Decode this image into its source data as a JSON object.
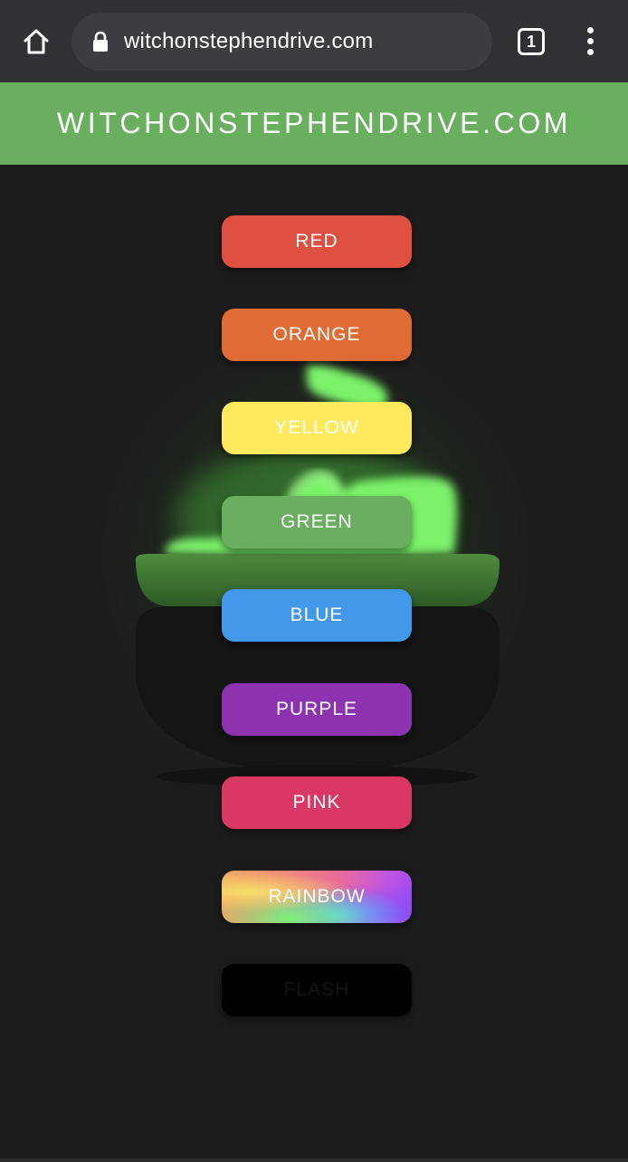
{
  "browser": {
    "url": "witchonstephendrive.com",
    "tab_count": "1",
    "icons": {
      "home": "home-icon",
      "lock": "lock-icon",
      "tabs": "tab-switcher-icon",
      "menu": "more-vert-icon"
    }
  },
  "header": {
    "title": "WITCHONSTEPHENDRIVE.COM",
    "background": "#6aaf5f"
  },
  "buttons": [
    {
      "label": "RED",
      "color": "#e05040"
    },
    {
      "label": "ORANGE",
      "color": "#e06b35"
    },
    {
      "label": "YELLOW",
      "color": "#ffe95c"
    },
    {
      "label": "GREEN",
      "color": "#6aaf5f"
    },
    {
      "label": "BLUE",
      "color": "#4498ea"
    },
    {
      "label": "PURPLE",
      "color": "#8e33b0"
    },
    {
      "label": "PINK",
      "color": "#d93865"
    },
    {
      "label": "RAINBOW",
      "color": "gradient"
    },
    {
      "label": "FLASH",
      "color": "#000000"
    }
  ],
  "scene": {
    "illustration": "cauldron-with-green-potion",
    "potion_color": "#7cf26a",
    "cauldron_color": "#151515"
  }
}
